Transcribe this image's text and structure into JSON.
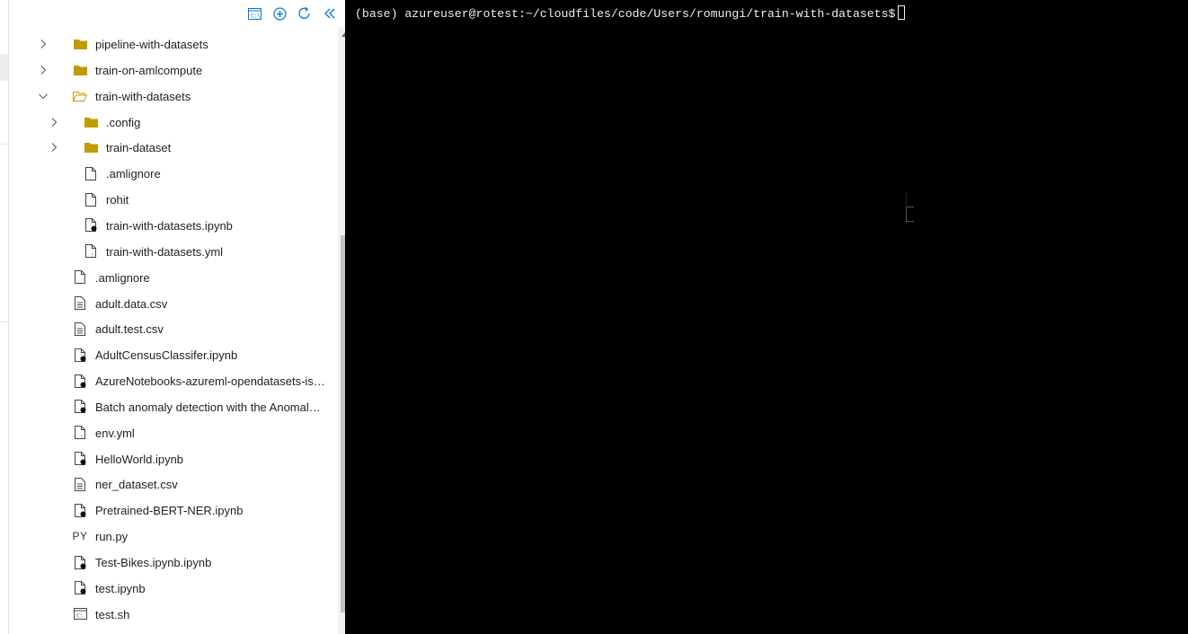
{
  "toolbar": {
    "new_terminal_icon": "terminal-icon",
    "add_icon": "add-icon",
    "refresh_icon": "refresh-icon",
    "collapse_icon": "collapse-icon"
  },
  "tree": [
    {
      "label": "pipeline-with-datasets",
      "type": "folder",
      "expanded": false
    },
    {
      "label": "train-on-amlcompute",
      "type": "folder",
      "expanded": false
    },
    {
      "label": "train-with-datasets",
      "type": "folder-open",
      "expanded": true
    },
    {
      "label": ".config",
      "type": "folder",
      "expanded": false
    },
    {
      "label": "train-dataset",
      "type": "folder",
      "expanded": false
    },
    {
      "label": ".amlignore",
      "type": "file"
    },
    {
      "label": "rohit",
      "type": "file"
    },
    {
      "label": "train-with-datasets.ipynb",
      "type": "notebook"
    },
    {
      "label": "train-with-datasets.yml",
      "type": "yml"
    },
    {
      "label": ".amlignore",
      "type": "file"
    },
    {
      "label": "adult.data.csv",
      "type": "csv"
    },
    {
      "label": "adult.test.csv",
      "type": "csv"
    },
    {
      "label": "AdultCensusClassifer.ipynb",
      "type": "notebook"
    },
    {
      "label": "AzureNotebooks-azureml-opendatasets-isd.i...",
      "type": "notebook"
    },
    {
      "label": "Batch anomaly detection with the Anomaly ...",
      "type": "notebook"
    },
    {
      "label": "env.yml",
      "type": "yml"
    },
    {
      "label": "HelloWorld.ipynb",
      "type": "notebook"
    },
    {
      "label": "ner_dataset.csv",
      "type": "csv"
    },
    {
      "label": "Pretrained-BERT-NER.ipynb",
      "type": "notebook"
    },
    {
      "label": "run.py",
      "type": "python",
      "glyph": "PY"
    },
    {
      "label": "Test-Bikes.ipynb.ipynb",
      "type": "notebook"
    },
    {
      "label": "test.ipynb",
      "type": "notebook"
    },
    {
      "label": "test.sh",
      "type": "shell"
    }
  ],
  "terminal": {
    "prompt": "(base) azureuser@rotest:~/cloudfiles/code/Users/romungi/train-with-datasets$"
  },
  "colors": {
    "folder": "#c19c00",
    "accent": "#0078d4",
    "terminal_bg": "#000000",
    "terminal_fg": "#f0f0f0"
  }
}
